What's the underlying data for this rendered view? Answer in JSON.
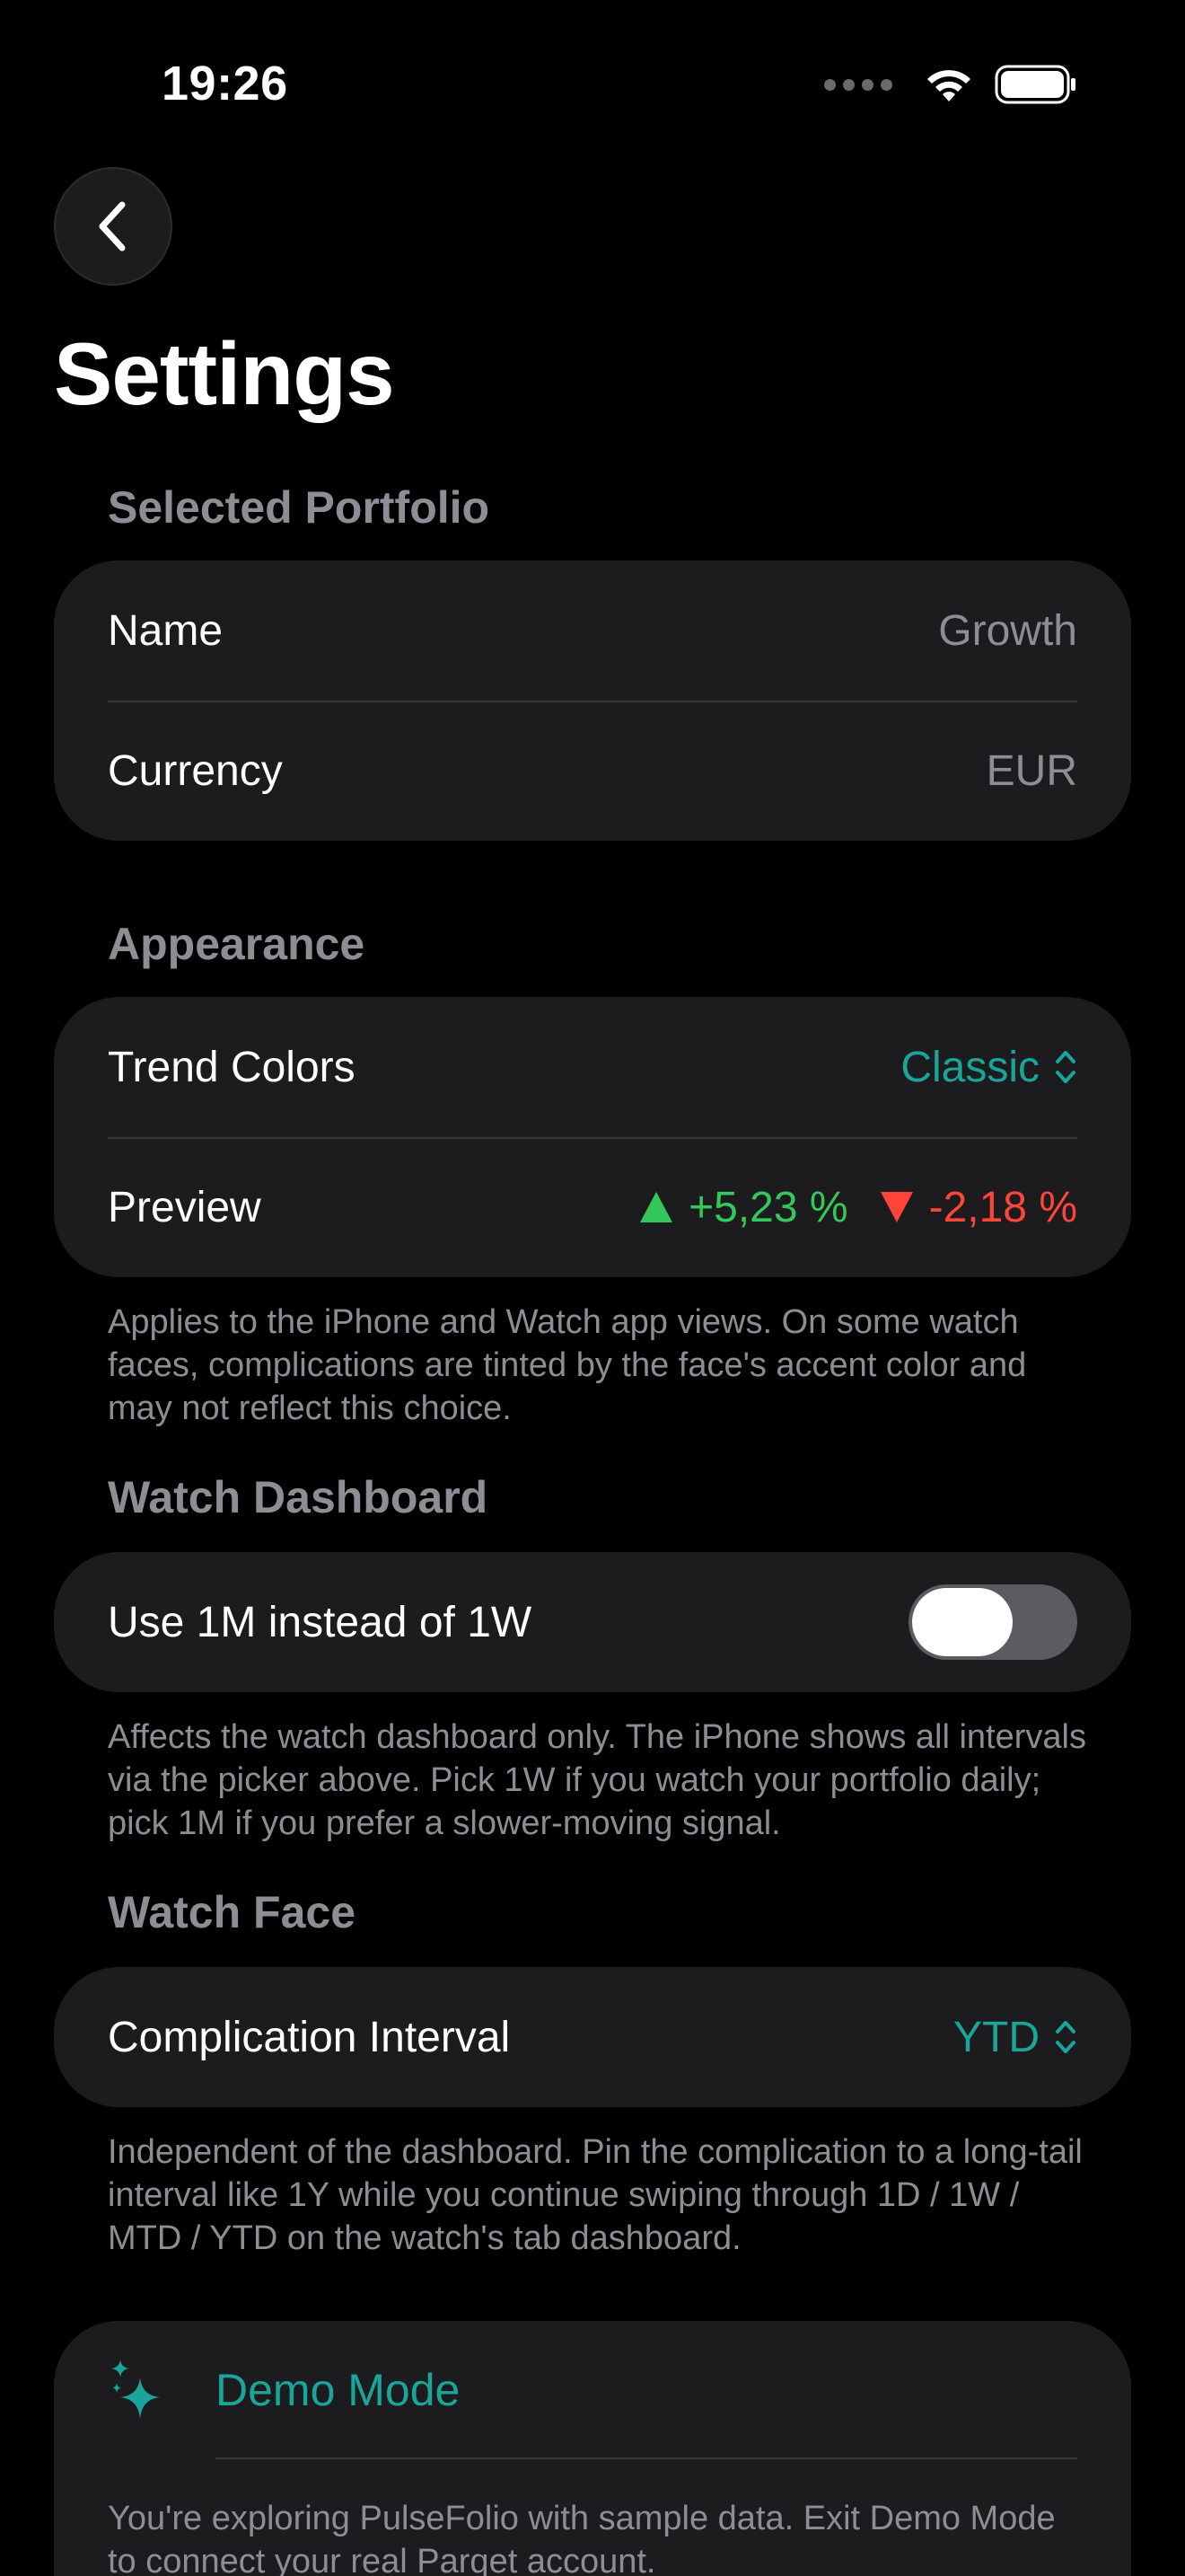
{
  "status_bar": {
    "time": "19:26"
  },
  "header": {
    "title": "Settings"
  },
  "selected_portfolio": {
    "header": "Selected Portfolio",
    "rows": [
      {
        "label": "Name",
        "value": "Growth"
      },
      {
        "label": "Currency",
        "value": "EUR"
      }
    ]
  },
  "appearance": {
    "header": "Appearance",
    "trend_colors": {
      "label": "Trend Colors",
      "value": "Classic"
    },
    "preview": {
      "label": "Preview",
      "up_value": "+5,23 %",
      "down_value": "-2,18 %"
    },
    "footnote": "Applies to the iPhone and Watch app views. On some watch faces, complications are tinted by the face's accent color and may not reflect this choice.",
    "colors": {
      "up": "#34c759",
      "down": "#ff453a"
    }
  },
  "watch_dashboard": {
    "header": "Watch Dashboard",
    "toggle": {
      "label": "Use 1M instead of 1W",
      "on": false
    },
    "footnote": "Affects the watch dashboard only. The iPhone shows all intervals via the picker above. Pick 1W if you watch your portfolio daily; pick 1M if you prefer a slower-moving signal."
  },
  "watch_face": {
    "header": "Watch Face",
    "complication": {
      "label": "Complication Interval",
      "value": "YTD"
    },
    "footnote": "Independent of the dashboard. Pin the complication to a long-tail interval like 1Y while you continue swiping through 1D / 1W / MTD / YTD on the watch's tab dashboard."
  },
  "demo_mode": {
    "title": "Demo Mode",
    "icon": "sparkles-icon",
    "text": "You're exploring PulseFolio with sample data. Exit Demo Mode to connect your real Parqet account."
  },
  "theme": {
    "accent": "#1aa59b",
    "background": "#000000",
    "card": "#1c1c1e",
    "secondary_text": "#8d8d93"
  }
}
